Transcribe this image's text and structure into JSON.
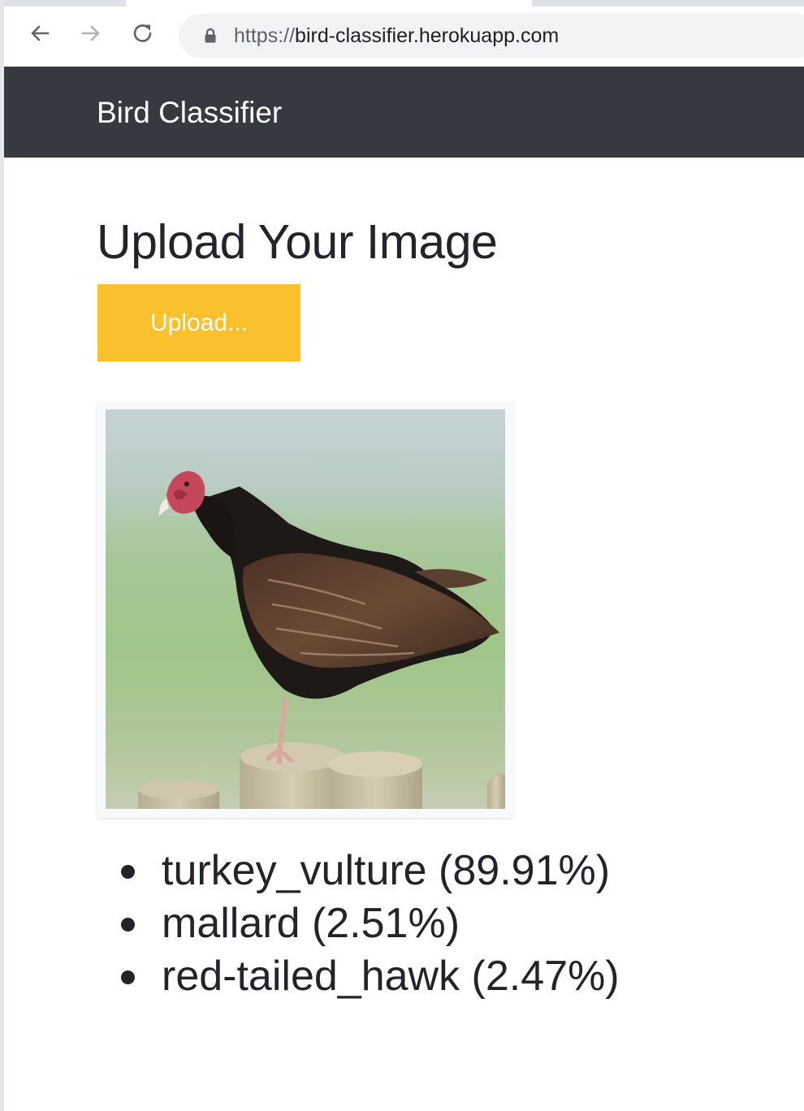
{
  "browser": {
    "url_scheme": "https://",
    "url_host": "bird-classifier.herokuapp.com",
    "back_icon": "arrow-left-icon",
    "forward_icon": "arrow-right-icon",
    "reload_icon": "reload-icon",
    "lock_icon": "lock-icon"
  },
  "navbar": {
    "brand": "Bird Classifier",
    "background": "#343a40"
  },
  "main": {
    "title": "Upload Your Image",
    "upload_button": "Upload...",
    "upload_button_color": "#fbc02d",
    "image_subject": "turkey vulture perched on a wooden fence post",
    "predictions": [
      {
        "label": "turkey_vulture (89.91%)"
      },
      {
        "label": "mallard (2.51%)"
      },
      {
        "label": "red-tailed_hawk (2.47%)"
      }
    ]
  }
}
